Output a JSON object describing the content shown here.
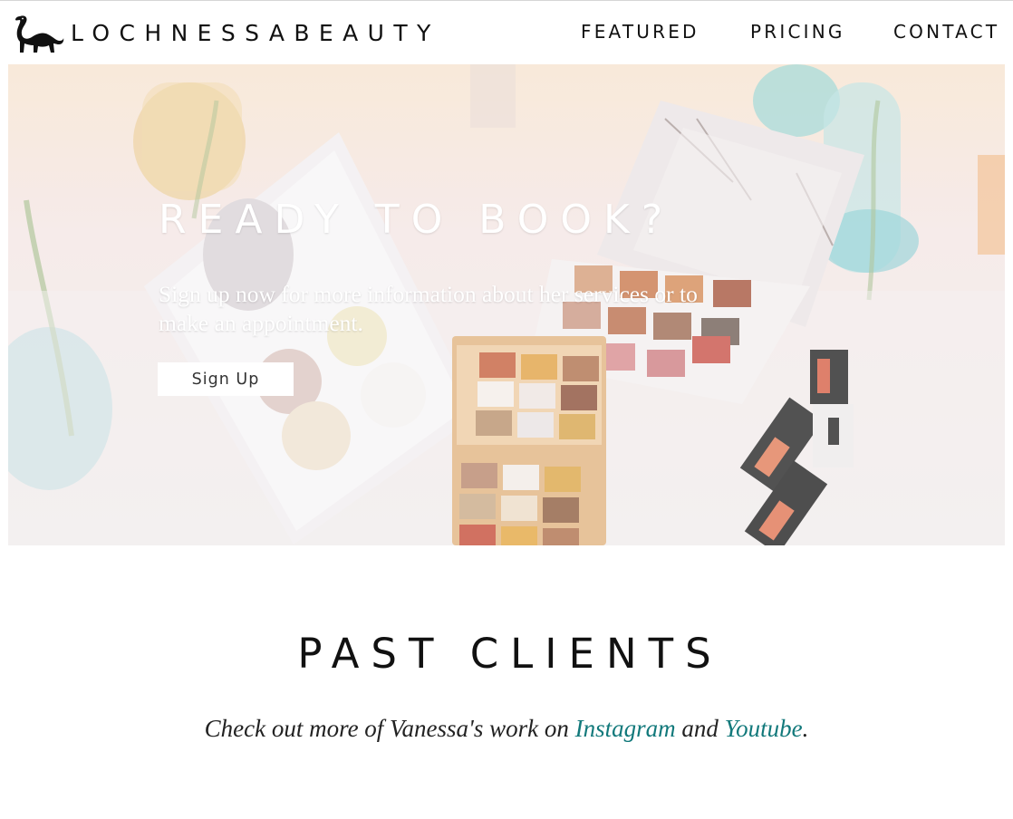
{
  "header": {
    "brand": "LOCHNESSABEAUTY",
    "nav": {
      "featured": "FEATURED",
      "pricing": "PRICING",
      "contact": "CONTACT"
    }
  },
  "hero": {
    "title": "READY TO BOOK?",
    "text": "Sign up now for more information about her services or to make an appointment.",
    "button_label": "Sign Up",
    "image": "makeup-palettes-photo"
  },
  "past_clients": {
    "title": "PAST CLIENTS",
    "text_before": "Check out more of Vanessa's work on",
    "instagram_label": "Instagram",
    "text_middle": "and",
    "youtube_label": "Youtube",
    "text_end": "."
  },
  "colors": {
    "link": "#12797b",
    "text": "#111111",
    "background": "#ffffff"
  },
  "icons": {
    "logo": "loch-ness-monster-icon"
  }
}
